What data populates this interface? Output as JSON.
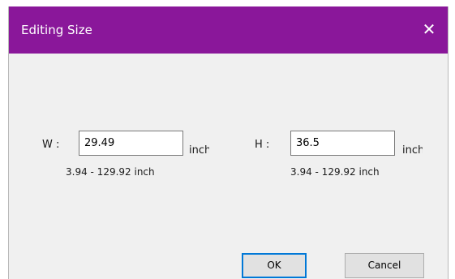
{
  "dialog": {
    "title": "Editing Size",
    "close_glyph": "✕"
  },
  "width": {
    "label": "W :",
    "value": "29.49",
    "unit": "inch",
    "range": "3.94 - 129.92 inch"
  },
  "height": {
    "label": "H :",
    "value": "36.5",
    "unit": "inch",
    "range": "3.94 - 129.92 inch"
  },
  "buttons": {
    "ok_label": "OK",
    "cancel_label": "Cancel"
  },
  "colors": {
    "titlebar": "#8a179a",
    "default_button_border": "#0078d7"
  }
}
